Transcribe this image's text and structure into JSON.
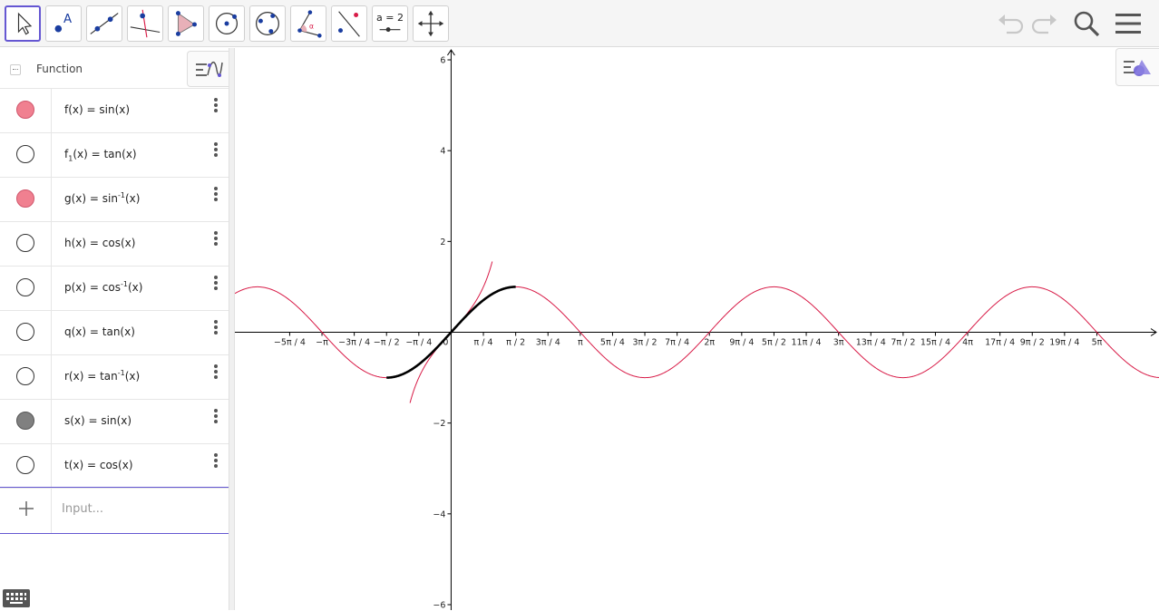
{
  "toolbar": {
    "tools": [
      {
        "name": "move-tool",
        "label": ""
      },
      {
        "name": "point-tool",
        "label": ""
      },
      {
        "name": "line-tool",
        "label": ""
      },
      {
        "name": "perpendicular-line-tool",
        "label": ""
      },
      {
        "name": "polygon-tool",
        "label": ""
      },
      {
        "name": "circle-center-point-tool",
        "label": ""
      },
      {
        "name": "circle-three-points-tool",
        "label": ""
      },
      {
        "name": "angle-tool",
        "label": ""
      },
      {
        "name": "reflect-tool",
        "label": ""
      },
      {
        "name": "slider-tool",
        "label": "a = 2"
      },
      {
        "name": "move-graphics-view-tool",
        "label": ""
      }
    ],
    "right_icons": [
      "undo-icon",
      "redo-icon",
      "search-icon",
      "menu-icon"
    ]
  },
  "algebra": {
    "header": "Function",
    "rows": [
      {
        "pre": "f(x) = sin(x)",
        "sub": "",
        "sup": "",
        "post": "",
        "visible": true,
        "color": "#f08090"
      },
      {
        "pre": "f",
        "sub": "1",
        "sup": "",
        "post": "(x) = tan(x)",
        "visible": false,
        "color": "#ffffff"
      },
      {
        "pre": "g(x) = sin",
        "sub": "",
        "sup": "-1",
        "post": "(x)",
        "visible": true,
        "color": "#f08090"
      },
      {
        "pre": "h(x) = cos(x)",
        "sub": "",
        "sup": "",
        "post": "",
        "visible": false,
        "color": "#ffffff"
      },
      {
        "pre": "p(x) = cos",
        "sub": "",
        "sup": "-1",
        "post": "(x)",
        "visible": false,
        "color": "#ffffff"
      },
      {
        "pre": "q(x) = tan(x)",
        "sub": "",
        "sup": "",
        "post": "",
        "visible": false,
        "color": "#ffffff"
      },
      {
        "pre": "r(x) = tan",
        "sub": "",
        "sup": "-1",
        "post": "(x)",
        "visible": false,
        "color": "#ffffff"
      },
      {
        "pre": "s(x) = sin(x)",
        "sub": "",
        "sup": "",
        "post": "",
        "visible": true,
        "color": "#808080"
      },
      {
        "pre": "t(x) = cos(x)",
        "sub": "",
        "sup": "",
        "post": "",
        "visible": false,
        "color": "#ffffff"
      }
    ],
    "input_placeholder": "Input..."
  },
  "graph": {
    "x_ticks": [
      "−5π / 4",
      "−π",
      "−3π / 4",
      "−π / 2",
      "−π / 4",
      "0",
      "π / 4",
      "π / 2",
      "3π / 4",
      "π",
      "5π / 4",
      "3π / 2",
      "7π / 4",
      "2π",
      "9π / 4",
      "5π / 2",
      "11π / 4",
      "3π",
      "13π / 4",
      "7π / 2",
      "15π / 4",
      "4π",
      "17π / 4",
      "9π / 2",
      "19π / 4",
      "5π"
    ],
    "y_ticks": [
      "6",
      "4",
      "2",
      "−2",
      "−4",
      "−6"
    ],
    "y_tick_values": [
      6,
      4,
      2,
      -2,
      -4,
      -6
    ],
    "x_range": [
      -5.26,
      17.22
    ],
    "y_range": [
      -6.12,
      6.26
    ],
    "colors": {
      "sine": "#d81b47",
      "tangent": "#d81b47",
      "arcsin": "#000000",
      "axes": "#000000"
    }
  }
}
